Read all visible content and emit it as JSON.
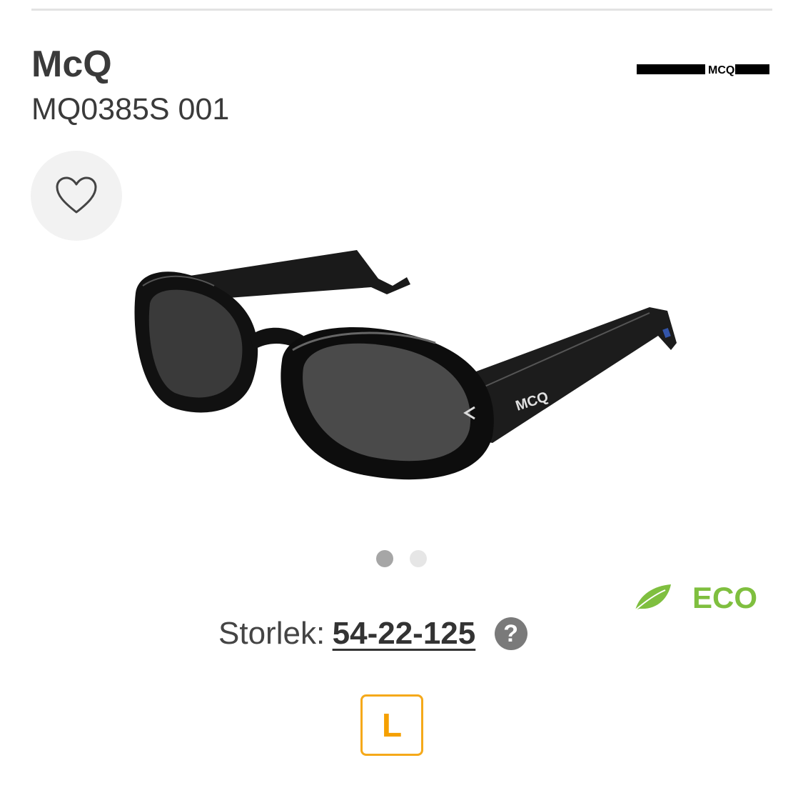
{
  "product": {
    "brand": "McQ",
    "model": "MQ0385S 001",
    "logo_text": "MCQ",
    "image_text": "MCQ"
  },
  "favorite": {
    "icon": "heart-outline-icon",
    "active": false
  },
  "gallery": {
    "image_count": 2,
    "active_index": 0
  },
  "eco": {
    "label": "ECO",
    "icon": "leaf-icon",
    "color": "#7fbf3f"
  },
  "size": {
    "label": "Storlek:",
    "value": "54-22-125",
    "help_icon": "?",
    "chip_label": "L",
    "chip_color": "#f5a91a"
  }
}
